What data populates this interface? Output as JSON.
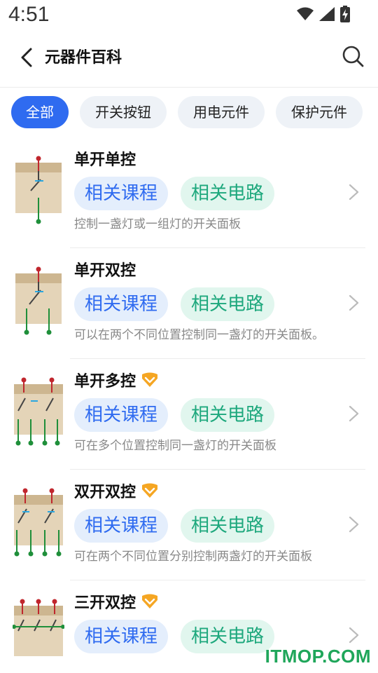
{
  "status_bar": {
    "time": "4:51",
    "icons": [
      "wifi-icon",
      "signal-icon",
      "battery-charging-icon"
    ]
  },
  "header": {
    "back_icon": "chevron-left-icon",
    "title": "元器件百科",
    "search_icon": "search-icon"
  },
  "tabs": [
    {
      "label": "全部",
      "active": true
    },
    {
      "label": "开关按钮",
      "active": false
    },
    {
      "label": "用电元件",
      "active": false
    },
    {
      "label": "保护元件",
      "active": false
    }
  ],
  "items": [
    {
      "title": "单开单控",
      "vip": false,
      "course_label": "相关课程",
      "circuit_label": "相关电路",
      "desc": "控制一盏灯或一组灯的开关面板"
    },
    {
      "title": "单开双控",
      "vip": false,
      "course_label": "相关课程",
      "circuit_label": "相关电路",
      "desc": "可以在两个不同位置控制同一盏灯的开关面板。"
    },
    {
      "title": "单开多控",
      "vip": true,
      "course_label": "相关课程",
      "circuit_label": "相关电路",
      "desc": "可在多个位置控制同一盏灯的开关面板"
    },
    {
      "title": "双开双控",
      "vip": true,
      "course_label": "相关课程",
      "circuit_label": "相关电路",
      "desc": "可在两个不同位置分别控制两盏灯的开关面板"
    },
    {
      "title": "三开双控",
      "vip": true,
      "course_label": "相关课程",
      "circuit_label": "相关电路",
      "desc": ""
    }
  ],
  "watermark": "ITMOP.COM",
  "colors": {
    "accent": "#2f6bf0",
    "course_bg": "#e4eefc",
    "circuit_text": "#1ea87d",
    "circuit_bg": "#e1f6ee",
    "vip": "#f5a623"
  }
}
